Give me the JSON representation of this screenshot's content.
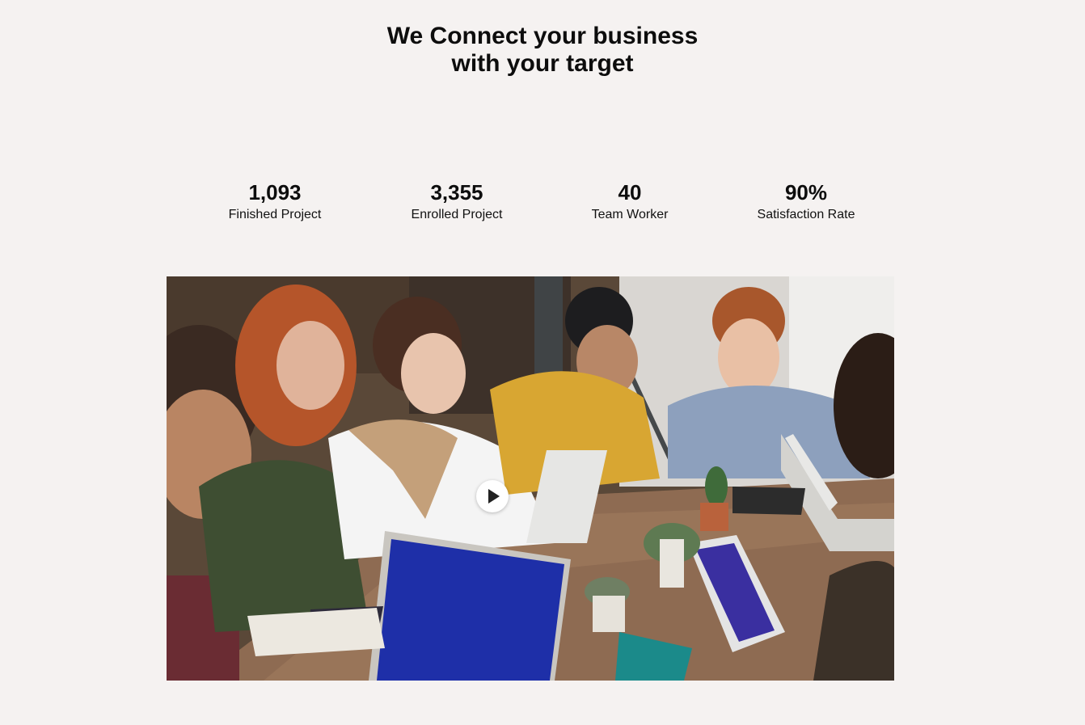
{
  "headline": {
    "line1": "We Connect your business",
    "line2": "with your target"
  },
  "stats": [
    {
      "value": "1,093",
      "label": "Finished Project"
    },
    {
      "value": "3,355",
      "label": "Enrolled Project"
    },
    {
      "value": "40",
      "label": "Team Worker"
    },
    {
      "value": "90%",
      "label": "Satisfaction Rate"
    }
  ],
  "video": {
    "play_icon": "play-icon"
  },
  "colors": {
    "background": "#f5f2f1",
    "text": "#0d0d0d"
  }
}
